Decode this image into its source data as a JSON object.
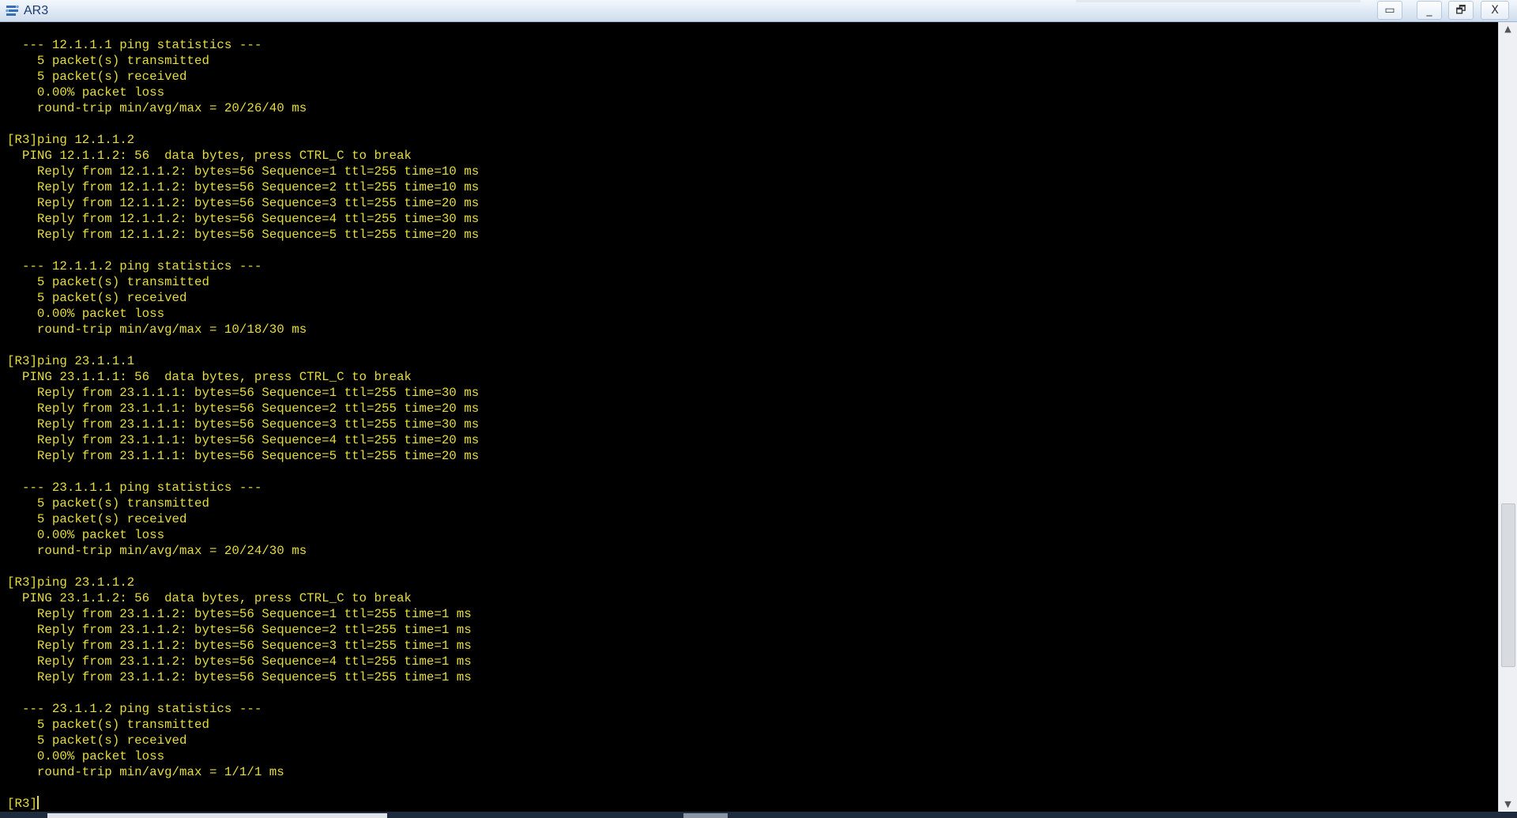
{
  "window": {
    "title": "AR3",
    "buttons": {
      "extra": "▭",
      "minimize": "_",
      "restore": "🗗",
      "close": "X"
    }
  },
  "terminal": {
    "text_color": "#e7de3c",
    "background": "#000000",
    "lines": [
      "  --- 12.1.1.1 ping statistics ---",
      "    5 packet(s) transmitted",
      "    5 packet(s) received",
      "    0.00% packet loss",
      "    round-trip min/avg/max = 20/26/40 ms",
      "",
      "[R3]ping 12.1.1.2",
      "  PING 12.1.1.2: 56  data bytes, press CTRL_C to break",
      "    Reply from 12.1.1.2: bytes=56 Sequence=1 ttl=255 time=10 ms",
      "    Reply from 12.1.1.2: bytes=56 Sequence=2 ttl=255 time=10 ms",
      "    Reply from 12.1.1.2: bytes=56 Sequence=3 ttl=255 time=20 ms",
      "    Reply from 12.1.1.2: bytes=56 Sequence=4 ttl=255 time=30 ms",
      "    Reply from 12.1.1.2: bytes=56 Sequence=5 ttl=255 time=20 ms",
      "",
      "  --- 12.1.1.2 ping statistics ---",
      "    5 packet(s) transmitted",
      "    5 packet(s) received",
      "    0.00% packet loss",
      "    round-trip min/avg/max = 10/18/30 ms",
      "",
      "[R3]ping 23.1.1.1",
      "  PING 23.1.1.1: 56  data bytes, press CTRL_C to break",
      "    Reply from 23.1.1.1: bytes=56 Sequence=1 ttl=255 time=30 ms",
      "    Reply from 23.1.1.1: bytes=56 Sequence=2 ttl=255 time=20 ms",
      "    Reply from 23.1.1.1: bytes=56 Sequence=3 ttl=255 time=30 ms",
      "    Reply from 23.1.1.1: bytes=56 Sequence=4 ttl=255 time=20 ms",
      "    Reply from 23.1.1.1: bytes=56 Sequence=5 ttl=255 time=20 ms",
      "",
      "  --- 23.1.1.1 ping statistics ---",
      "    5 packet(s) transmitted",
      "    5 packet(s) received",
      "    0.00% packet loss",
      "    round-trip min/avg/max = 20/24/30 ms",
      "",
      "[R3]ping 23.1.1.2",
      "  PING 23.1.1.2: 56  data bytes, press CTRL_C to break",
      "    Reply from 23.1.1.2: bytes=56 Sequence=1 ttl=255 time=1 ms",
      "    Reply from 23.1.1.2: bytes=56 Sequence=2 ttl=255 time=1 ms",
      "    Reply from 23.1.1.2: bytes=56 Sequence=3 ttl=255 time=1 ms",
      "    Reply from 23.1.1.2: bytes=56 Sequence=4 ttl=255 time=1 ms",
      "    Reply from 23.1.1.2: bytes=56 Sequence=5 ttl=255 time=1 ms",
      "",
      "  --- 23.1.1.2 ping statistics ---",
      "    5 packet(s) transmitted",
      "    5 packet(s) received",
      "    0.00% packet loss",
      "    round-trip min/avg/max = 1/1/1 ms",
      ""
    ],
    "prompt": "[R3]"
  },
  "scrollbar": {
    "up_arrow": "▲",
    "down_arrow": "▼",
    "position_fraction": 0.78
  }
}
